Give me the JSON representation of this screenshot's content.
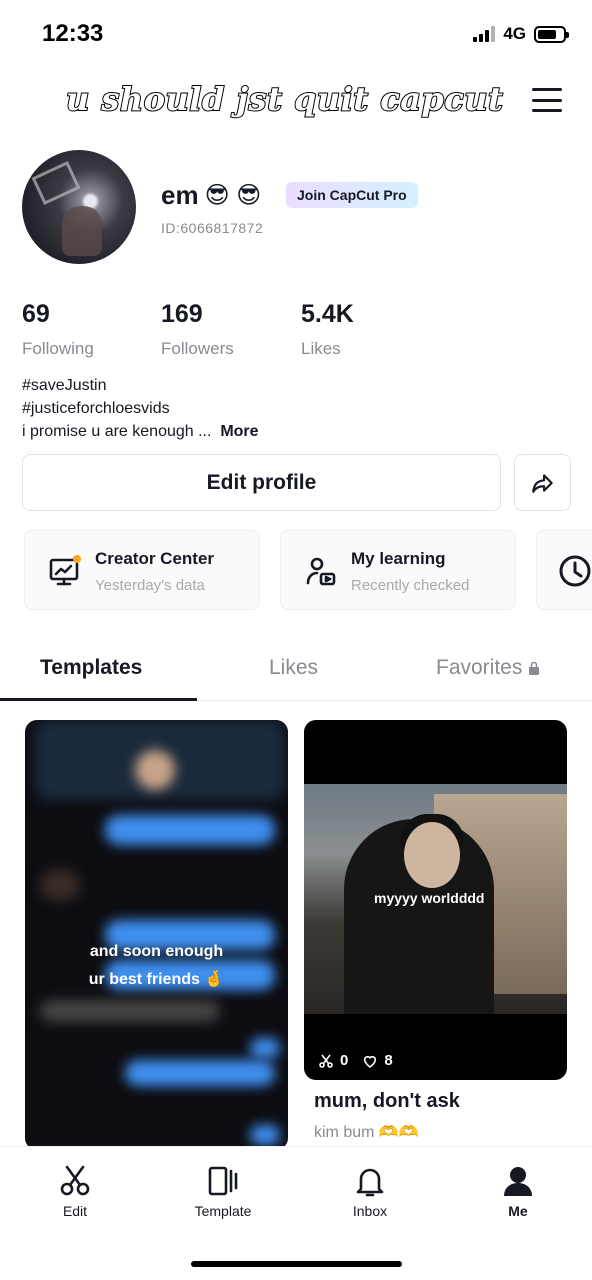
{
  "status_bar": {
    "time": "12:33",
    "network": "4G"
  },
  "header": {
    "title": "u should jst quit capcut"
  },
  "profile": {
    "name": "em",
    "emojis": "😎 😎",
    "pro_badge": "Join CapCut Pro",
    "id": "ID:6066817872"
  },
  "stats": [
    {
      "value": "69",
      "label": "Following"
    },
    {
      "value": "169",
      "label": "Followers"
    },
    {
      "value": "5.4K",
      "label": "Likes"
    }
  ],
  "bio": {
    "line1": "#saveJustin",
    "line2": "#justiceforchloesvids",
    "line3": "i promise u are kenough ...",
    "more": "More"
  },
  "actions": {
    "edit_profile": "Edit profile"
  },
  "cards": [
    {
      "title": "Creator Center",
      "subtitle": "Yesterday's data"
    },
    {
      "title": "My learning",
      "subtitle": "Recently checked"
    }
  ],
  "tabs": [
    {
      "label": "Templates"
    },
    {
      "label": "Likes"
    },
    {
      "label": "Favorites"
    }
  ],
  "templates": [
    {
      "caption_line1": "and soon enough",
      "caption_line2": "ur best friends 🤞"
    },
    {
      "overlay_text": "myyyy worldddd",
      "uses": "0",
      "likes": "8",
      "title": "mum, don't ask",
      "author": "kim bum 🫶🫶"
    }
  ],
  "bottom_nav": [
    {
      "label": "Edit"
    },
    {
      "label": "Template"
    },
    {
      "label": "Inbox"
    },
    {
      "label": "Me"
    }
  ]
}
